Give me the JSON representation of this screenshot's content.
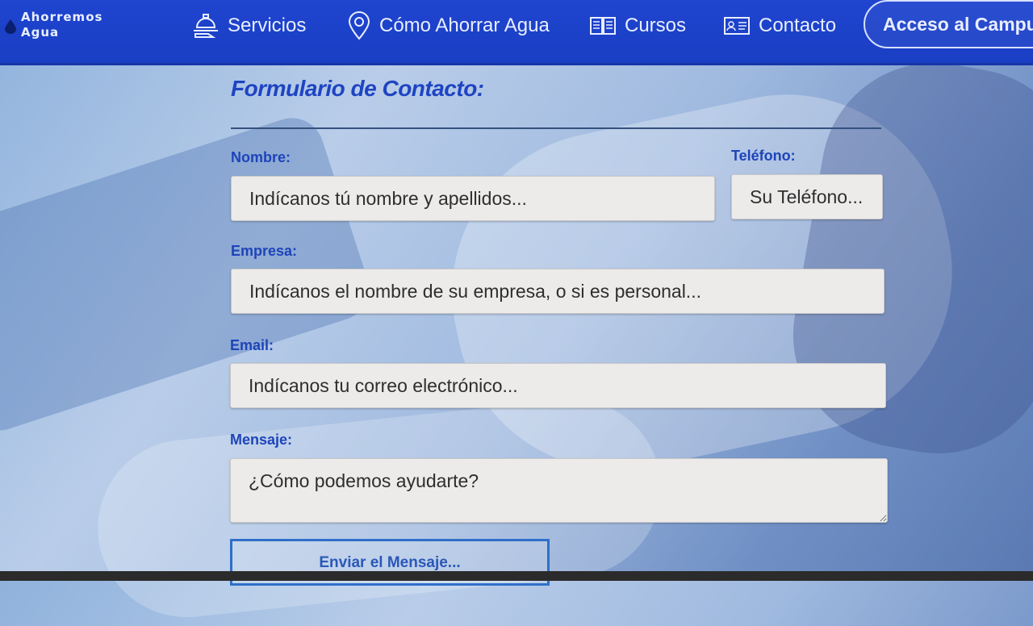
{
  "nav": {
    "logo_line1": "Ahorremos",
    "logo_line2": "Agua",
    "items": [
      {
        "label": "Servicios",
        "icon": "services-icon"
      },
      {
        "label": "Cómo Ahorrar Agua",
        "icon": "location-pin-icon"
      },
      {
        "label": "Cursos",
        "icon": "book-icon"
      },
      {
        "label": "Contacto",
        "icon": "contact-card-icon"
      }
    ],
    "campus_button": "Acceso al Campus"
  },
  "form": {
    "title": "Formulario de Contacto:",
    "nombre": {
      "label": "Nombre:",
      "placeholder": "Indícanos tú nombre y apellidos..."
    },
    "telefono": {
      "label": "Teléfono:",
      "placeholder": "Su Teléfono..."
    },
    "empresa": {
      "label": "Empresa:",
      "placeholder": "Indícanos el nombre de su empresa, o si es personal..."
    },
    "email": {
      "label": "Email:",
      "placeholder": "Indícanos tu correo electrónico..."
    },
    "mensaje": {
      "label": "Mensaje:",
      "placeholder": "¿Cómo podemos ayudarte?"
    },
    "submit": "Enviar el Mensaje..."
  },
  "colors": {
    "navbar": "#1f44cf",
    "title": "#1e44c2",
    "label": "#1e44b8",
    "field_bg": "#ecebea"
  }
}
